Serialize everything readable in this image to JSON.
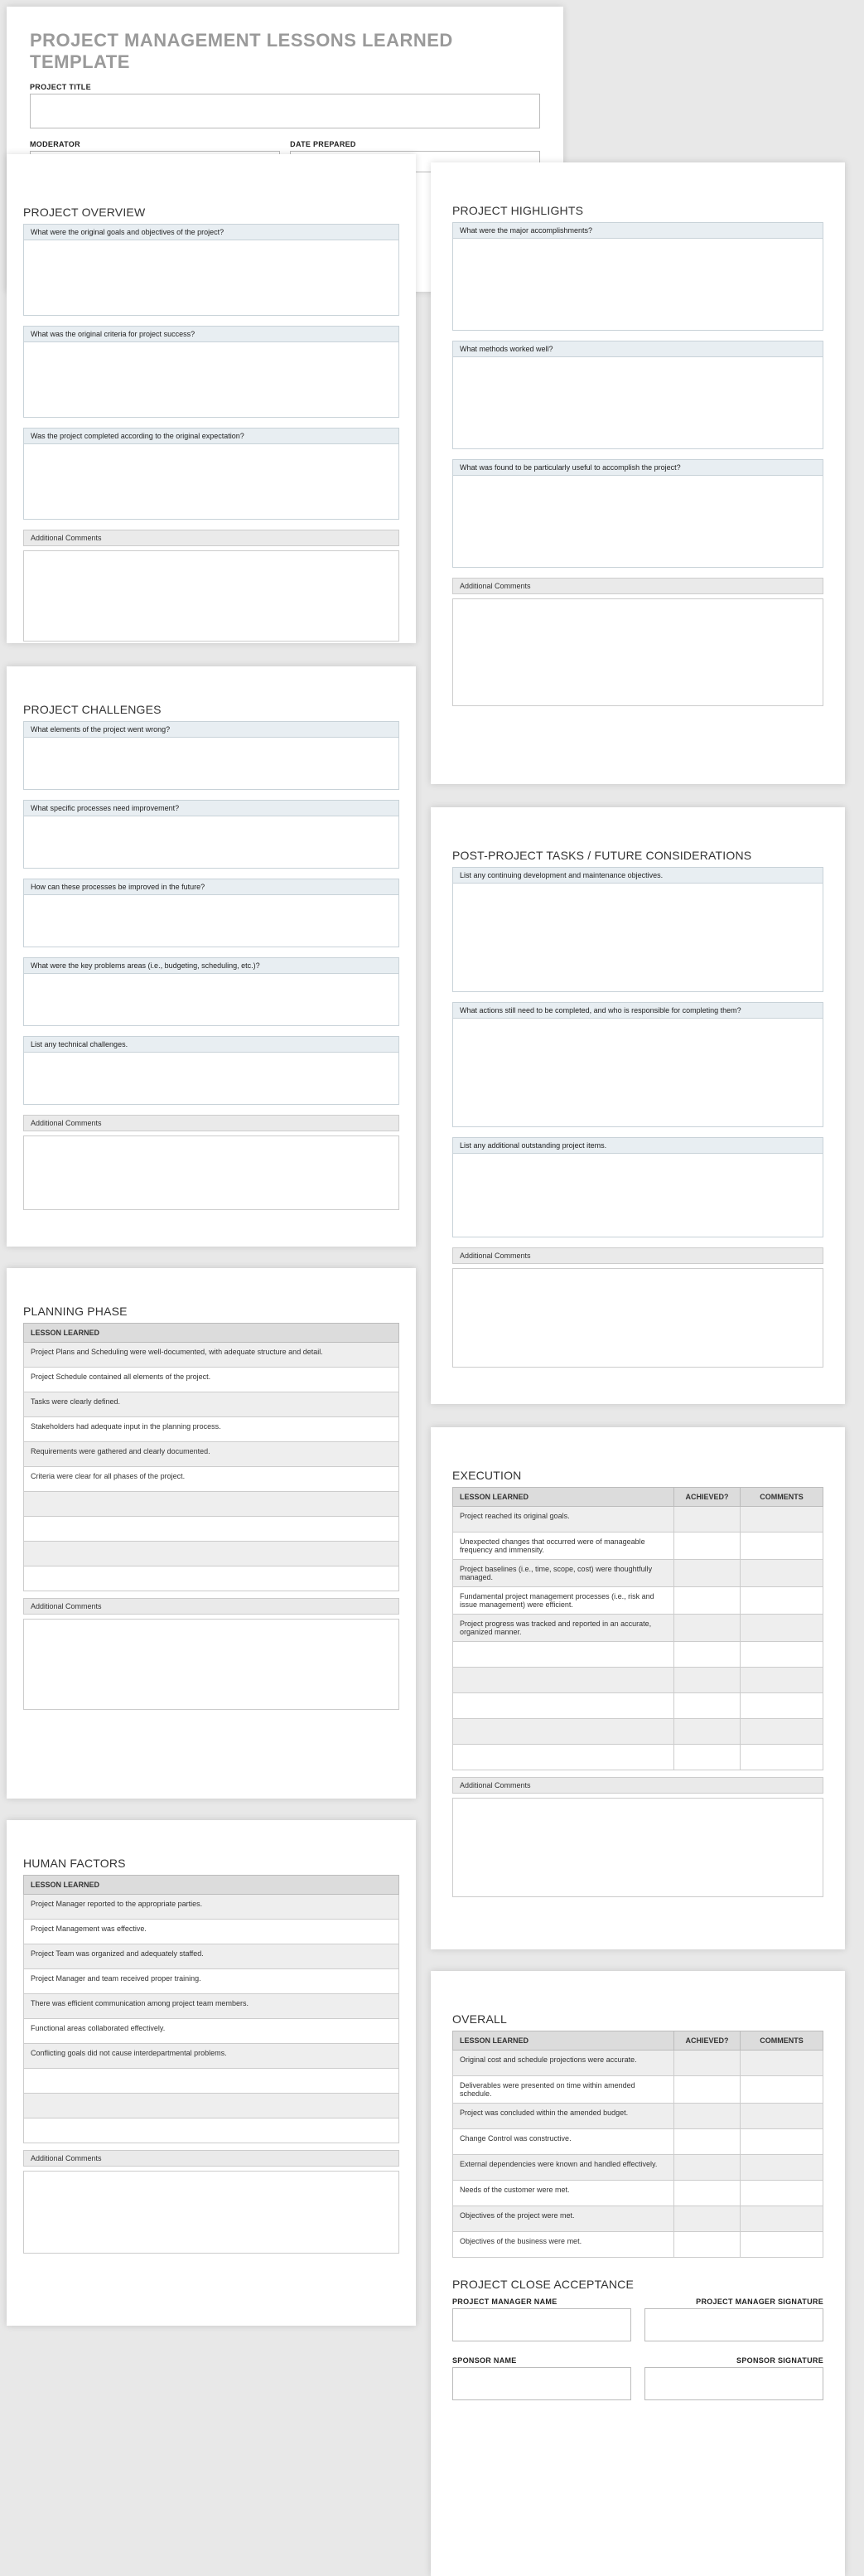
{
  "doc": {
    "title": "PROJECT MANAGEMENT LESSONS LEARNED TEMPLATE"
  },
  "header": {
    "projectTitleLbl": "PROJECT TITLE",
    "moderatorLbl": "MODERATOR",
    "dateLbl": "DATE PREPARED"
  },
  "overview": {
    "heading": "PROJECT OVERVIEW",
    "q": [
      "What were the original goals and objectives of the project?",
      "What was the original criteria for project success?",
      "Was the project completed according to the original expectation?"
    ],
    "addl": "Additional Comments"
  },
  "highlights": {
    "heading": "PROJECT HIGHLIGHTS",
    "q": [
      "What were the major accomplishments?",
      "What methods worked well?",
      "What was found to be particularly useful to accomplish the project?"
    ],
    "addl": "Additional Comments"
  },
  "challenges": {
    "heading": "PROJECT CHALLENGES",
    "q": [
      "What elements of the project went wrong?",
      "What specific processes need improvement?",
      "How can these processes be improved in the future?",
      "What were the key problems areas (i.e., budgeting, scheduling, etc.)?",
      "List any technical challenges."
    ],
    "addl": "Additional Comments"
  },
  "postproject": {
    "heading": "POST-PROJECT TASKS / FUTURE CONSIDERATIONS",
    "q": [
      "List any continuing development and maintenance objectives.",
      "What actions still need to be completed, and who is responsible for completing them?",
      "List any additional outstanding project items."
    ],
    "addl": "Additional Comments"
  },
  "planning": {
    "heading": "PLANNING PHASE",
    "col": "LESSON LEARNED",
    "rows": [
      "Project Plans and Scheduling were well-documented, with adequate structure and detail.",
      "Project Schedule contained all elements of the project.",
      "Tasks were clearly defined.",
      "Stakeholders had adequate input in the planning process.",
      "Requirements were gathered and clearly documented.",
      "Criteria were clear for all phases of the project.",
      "",
      "",
      "",
      ""
    ],
    "addl": "Additional Comments"
  },
  "human": {
    "heading": "HUMAN FACTORS",
    "col": "LESSON LEARNED",
    "rows": [
      "Project Manager reported to the appropriate parties.",
      "Project Management was effective.",
      "Project Team was organized and adequately staffed.",
      "Project Manager and team received proper training.",
      "There was efficient communication among project team members.",
      "Functional areas collaborated effectively.",
      "Conflicting goals did not cause interdepartmental problems.",
      "",
      "",
      ""
    ],
    "addl": "Additional Comments"
  },
  "execution": {
    "heading": "EXECUTION",
    "cols": {
      "lesson": "LESSON LEARNED",
      "ach": "ACHIEVED?",
      "com": "COMMENTS"
    },
    "rows": [
      "Project reached its original goals.",
      "Unexpected changes that occurred were of manageable frequency and immensity.",
      "Project baselines (i.e., time, scope, cost) were thoughtfully managed.",
      "Fundamental project management processes (i.e., risk and issue management) were efficient.",
      "Project progress was tracked and reported in an accurate, organized manner.",
      "",
      "",
      "",
      "",
      ""
    ],
    "addl": "Additional Comments"
  },
  "overall": {
    "heading": "OVERALL",
    "cols": {
      "lesson": "LESSON LEARNED",
      "ach": "ACHIEVED?",
      "com": "COMMENTS"
    },
    "rows": [
      "Original cost and schedule projections were accurate.",
      "Deliverables were presented on time within amended schedule.",
      "Project was concluded within the amended budget.",
      "Change Control was constructive.",
      "External dependencies were known and handled effectively.",
      "Needs of the customer were met.",
      "Objectives of the project were met.",
      "Objectives of the business were met."
    ]
  },
  "acceptance": {
    "heading": "PROJECT CLOSE ACCEPTANCE",
    "pmName": "PROJECT MANAGER NAME",
    "pmSig": "PROJECT MANAGER SIGNATURE",
    "spName": "SPONSOR NAME",
    "spSig": "SPONSOR SIGNATURE"
  }
}
